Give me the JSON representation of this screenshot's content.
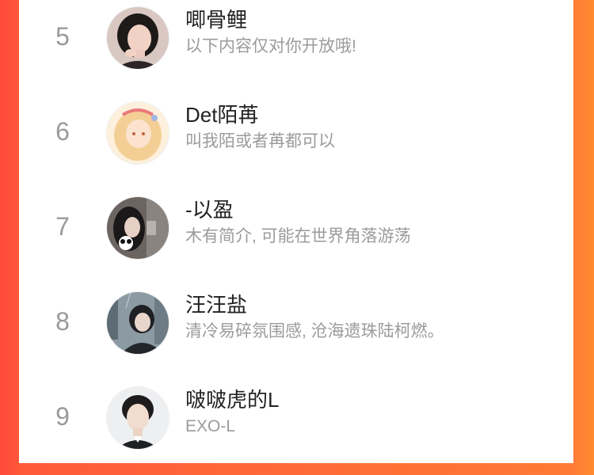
{
  "ranking": [
    {
      "rank": "5",
      "name": "唧骨鲤",
      "desc": "以下内容仅对你开放哦!",
      "avatar_icon": "portrait-girl-dark-hair",
      "avatar_bg": "#d9c9c3"
    },
    {
      "rank": "6",
      "name": "Det陌苒",
      "desc": "叫我陌或者苒都可以",
      "avatar_icon": "portrait-anime-girl-blonde",
      "avatar_bg": "#fbe6c8"
    },
    {
      "rank": "7",
      "name": "-以盈",
      "desc": "木有简介, 可能在世界角落游荡",
      "avatar_icon": "portrait-girl-with-panda",
      "avatar_bg": "#5a5552"
    },
    {
      "rank": "8",
      "name": "汪汪盐",
      "desc": "清冷易碎氛围感, 沧海遗珠陆柯燃。",
      "avatar_icon": "portrait-anime-boy-rain",
      "avatar_bg": "#7a8a93"
    },
    {
      "rank": "9",
      "name": "啵啵虎的L",
      "desc": "EXO-L",
      "avatar_icon": "portrait-young-man",
      "avatar_bg": "#e9eaec"
    }
  ]
}
